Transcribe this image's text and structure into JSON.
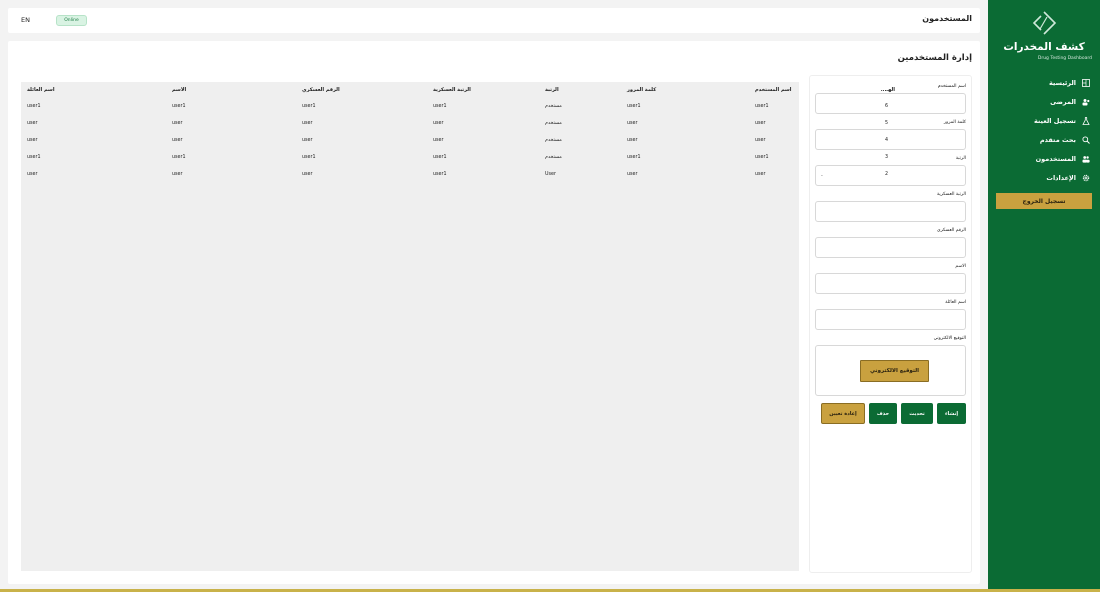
{
  "sidebar": {
    "brand_title": "كشف المخدرات",
    "brand_subtitle": "Drug Testing Dashboard",
    "items": [
      {
        "label": "الرئيسية",
        "icon": "dashboard-icon"
      },
      {
        "label": "المرضى",
        "icon": "patients-icon"
      },
      {
        "label": "تسجيل العينة",
        "icon": "flask-icon"
      },
      {
        "label": "بحث متقدم",
        "icon": "search-icon"
      },
      {
        "label": "المستخدمون",
        "icon": "users-icon"
      },
      {
        "label": "الإعدادات",
        "icon": "gear-icon"
      }
    ],
    "logout_label": "تسجيل الخروج"
  },
  "header": {
    "title": "المستخدمون",
    "lang_label": "EN",
    "status_label": "Online"
  },
  "main": {
    "page_title": "إدارة المستخدمين"
  },
  "form": {
    "username_label": "اسم المستخدم",
    "password_label": "كلمة المرور",
    "role_label": "الرتبة",
    "role_value": "-",
    "military_rank_label": "الرتبة العسكرية",
    "military_number_label": "الرقم العسكري",
    "name_label": "الاسم",
    "family_name_label": "اسم العائلة",
    "signature_label": "التوقيع الالكتروني",
    "signature_button": "التوقيع الالكتروني",
    "create_button": "إنشاء",
    "update_button": "تحديث",
    "delete_button": "حذف",
    "reset_button": "إعادة تعيين"
  },
  "table": {
    "headers": [
      "الهـ...",
      "اسم المستخدم",
      "كلمة المرور",
      "الرتبة",
      "الرتبة العسكرية",
      "الرقم العسكري",
      "الاسم",
      "اسم العائلة"
    ],
    "rows": [
      [
        "6",
        "user1",
        "user1",
        "مستخدم",
        "user1",
        "user1",
        "user1",
        "user1"
      ],
      [
        "5",
        "user",
        "user",
        "مستخدم",
        "user",
        "user",
        "user",
        "user"
      ],
      [
        "4",
        "user",
        "user",
        "مستخدم",
        "user",
        "user",
        "user",
        "user"
      ],
      [
        "3",
        "user1",
        "user1",
        "مستخدم",
        "user1",
        "user1",
        "user1",
        "user1"
      ],
      [
        "2",
        "user",
        "user",
        "User",
        "user1",
        "user",
        "user",
        "user"
      ]
    ]
  },
  "colors": {
    "primary": "#0b6b34",
    "accent": "#c9a13f",
    "badge_bg": "#d9f3e3"
  }
}
